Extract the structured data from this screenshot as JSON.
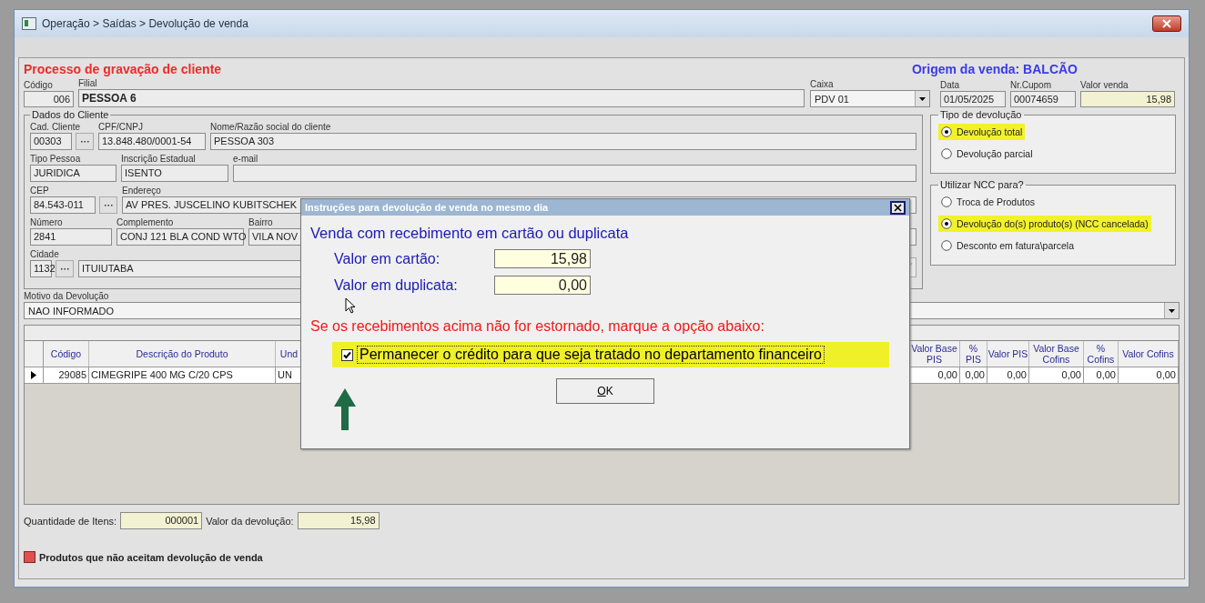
{
  "window": {
    "title": "Operação > Saídas > Devolução de venda"
  },
  "form": {
    "heading": "Processo de gravação de cliente",
    "origin": "Origem da venda: BALCÃO",
    "top_fields": [
      {
        "kind": "text",
        "label": "Código",
        "value": "006"
      },
      {
        "kind": "text",
        "label": "Filial",
        "value": "PESSOA 6"
      },
      {
        "kind": "select",
        "label": "Caixa",
        "value": "PDV 01"
      },
      {
        "kind": "text",
        "label": "Data",
        "value": "01/05/2025"
      },
      {
        "kind": "text",
        "label": "Nr.Cupom",
        "value": "00074659"
      },
      {
        "kind": "total",
        "label": "Valor venda",
        "value": "15,98"
      }
    ]
  },
  "client_group": {
    "title": "Dados do Cliente",
    "rows": [
      [
        {
          "label": "Cad. Cliente",
          "value": "00303",
          "lookup": true
        },
        {
          "label": "CPF/CNPJ",
          "value": "13.848.480/0001-54",
          "lookup": false
        },
        {
          "label": "Nome/Razão social do cliente",
          "value": "PESSOA 303",
          "lookup": false
        }
      ],
      [
        {
          "label": "Tipo Pessoa",
          "value": "JURIDICA",
          "lookup": false
        },
        {
          "label": "Inscrição Estadual",
          "value": "ISENTO",
          "lookup": false
        },
        {
          "label": "e-mail",
          "lookup": false
        }
      ],
      [
        {
          "label": "CEP",
          "value": "84.543-011",
          "lookup": true
        },
        {
          "label": "Endereço",
          "value": "AV PRES. JUSCELINO KUBITSCHEK",
          "lookup": false
        }
      ],
      [
        {
          "label": "Número",
          "value": "2841",
          "lookup": false
        },
        {
          "label": "Complemento",
          "value": "CONJ 121 BLA COND WTO",
          "lookup": false
        },
        {
          "label": "Bairro",
          "value": "VILA NOV",
          "lookup": false
        }
      ],
      [
        {
          "label": "Cidade",
          "value": "1132",
          "lookup": true
        },
        {
          "value": "ITUIUTABA",
          "lookup": false
        }
      ]
    ]
  },
  "return_type": {
    "title": "Tipo de devolução",
    "options": [
      {
        "label": "Devolução total",
        "selected": true,
        "highlighted": true
      },
      {
        "label": "Devolução parcial",
        "selected": false,
        "highlighted": false
      }
    ]
  },
  "ncc_use": {
    "title": "Utilizar NCC para?",
    "options": [
      {
        "label": "Troca de Produtos",
        "selected": false,
        "highlighted": false
      },
      {
        "label": "Devolução do(s) produto(s) (NCC cancelada)",
        "selected": true,
        "highlighted": true
      },
      {
        "label": "Desconto em fatura\\parcela",
        "selected": false,
        "highlighted": false
      }
    ]
  },
  "reason": {
    "label": "Motivo da Devolução",
    "value": "NAO INFORMADO"
  },
  "table": {
    "columns": [
      "Código",
      "Descrição do Produto",
      "Und",
      "Valor Base PIS",
      "% PIS",
      "Valor PIS",
      "Valor Base Cofins",
      "% Cofins",
      "Valor Cofins"
    ],
    "rows": [
      {
        "current": true,
        "cells": [
          "29085",
          "CIMEGRIPE 400 MG C/20 CPS",
          "UN",
          "0,00",
          "0,00",
          "0,00",
          "0,00",
          "0,00",
          "0,00"
        ]
      }
    ]
  },
  "totals": [
    {
      "label": "Quantidade de Itens:",
      "value": "000001"
    },
    {
      "label": "Valor da devolução:",
      "value": "15,98"
    }
  ],
  "legend": {
    "label": "Produtos que não aceitam devolução de venda",
    "color": "#e05050"
  },
  "dialog": {
    "title": "Instruções para devolução de venda no mesmo dia",
    "heading": "Venda com recebimento em cartão ou duplicata",
    "fields": [
      {
        "label": "Valor em cartão:",
        "value": "15,98"
      },
      {
        "label": "Valor em duplicata:",
        "value": "0,00"
      }
    ],
    "warning": "Se os recebimentos acima não for estornado, marque a opção abaixo:",
    "option": {
      "label": "Permanecer o crédito para que seja tratado no departamento financeiro",
      "checked": true,
      "highlighted": true
    },
    "ok_button": "OK"
  }
}
